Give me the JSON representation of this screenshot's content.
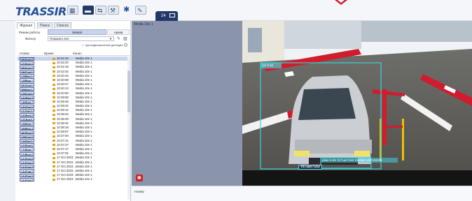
{
  "app": {
    "logo": "TRASSIR",
    "toolbar_icons": [
      "grid-icon",
      "monitor-icon",
      "layout-icon",
      "wrench-icon",
      "puzzle-icon",
      "edit-icon"
    ],
    "camera_tab_label": "24"
  },
  "left_panel": {
    "tabs": [
      "Журнал",
      "Поиск",
      "Список"
    ],
    "mode_label": "Режим работы",
    "mode_options": [
      "Живой",
      "Архив"
    ],
    "filter_label": "Фильтр",
    "filter_value": "Показать все",
    "checkbox_label": "при видеозаписной детекции",
    "columns": [
      "Номер",
      "Время",
      "Канал"
    ],
    "rows": [
      {
        "num": "т571ах?",
        "time": "10:42:43",
        "channel": "Media 10e 1"
      },
      {
        "num": "т732хс?",
        "time": "10:42:20",
        "channel": "Media 10e 1"
      },
      {
        "num": "т941ах?",
        "time": "10:42:18",
        "channel": "Media 10e 1"
      },
      {
        "num": "т607ак?",
        "time": "10:42:02",
        "channel": "Media 10e 1"
      },
      {
        "num": "т258кс?",
        "time": "10:40:44",
        "channel": "Media 10e 1"
      },
      {
        "num": "т295ах?",
        "time": "10:40:08",
        "channel": "Media 10e 1"
      },
      {
        "num": "т674ак?",
        "time": "10:40:27",
        "channel": "Media 10e 1"
      },
      {
        "num": "т664кс?",
        "time": "10:40:13",
        "channel": "Media 10e 1"
      },
      {
        "num": "т757ак?",
        "time": "10:40:00",
        "channel": "Media 10e 1"
      },
      {
        "num": "т418ох?",
        "time": "10:39:58",
        "channel": "Media 10e 1"
      },
      {
        "num": "т400ох?",
        "time": "10:39:46",
        "channel": "Media 10e 1"
      },
      {
        "num": "т422ах?",
        "time": "10:39:22",
        "channel": "Media 10e 1"
      },
      {
        "num": "т127кс?",
        "time": "10:39:12",
        "channel": "Media 10e 1"
      },
      {
        "num": "т425ах?",
        "time": "10:39:03",
        "channel": "Media 10e 1"
      },
      {
        "num": "т115ак?",
        "time": "10:38:49",
        "channel": "Media 10e 1"
      },
      {
        "num": "т253ох?",
        "time": "10:38:32",
        "channel": "Media 10e 1"
      },
      {
        "num": "т909ох?",
        "time": "10:38:18",
        "channel": "Media 10e 1"
      },
      {
        "num": "т670ах?",
        "time": "10:38:07",
        "channel": "Media 10e 1"
      },
      {
        "num": "т257ах?",
        "time": "10:37:50",
        "channel": "Media 10e 1"
      },
      {
        "num": "т163кс?",
        "time": "10:37:41",
        "channel": "Media 10e 1"
      },
      {
        "num": "т276ак?",
        "time": "10:37:27",
        "channel": "Media 10e 1"
      },
      {
        "num": "т725ах?",
        "time": "10:37:17",
        "channel": "Media 10e 1"
      },
      {
        "num": "т745ах?",
        "time": "10:37:02",
        "channel": "Media 10e 1"
      },
      {
        "num": "т137ах?",
        "time": "17 Oct 2023 ...",
        "channel": "Media 10e 1"
      },
      {
        "num": "т137ах?",
        "time": "17 Oct 2023 ...",
        "channel": "Media 10e 1"
      },
      {
        "num": "т137ах?",
        "time": "17 Oct 2023 ...",
        "channel": "Media 10e 1"
      },
      {
        "num": "т137ах?",
        "time": "17 Oct 2023 ...",
        "channel": "Media 10e 1"
      },
      {
        "num": "т137ах?",
        "time": "17 Oct 2023 ...",
        "channel": "Media 10e 1"
      },
      {
        "num": "т137ах?",
        "time": "17 Oct 2023 ...",
        "channel": "Media 10e 1"
      }
    ],
    "selected_row": 0
  },
  "video": {
    "camera_name": "Media 10e 1",
    "car_label": "car 0.94",
    "plate_label": "т571ах?163",
    "plate_info": "plate 0.98 т571ах?163 Russia 1.00 152.68",
    "colors": {
      "barrier_red": "#d01c2c",
      "detection_box": "#3fd0d8",
      "record_button": "#d52020"
    }
  },
  "bottom_panel": {
    "label": "Номер"
  }
}
